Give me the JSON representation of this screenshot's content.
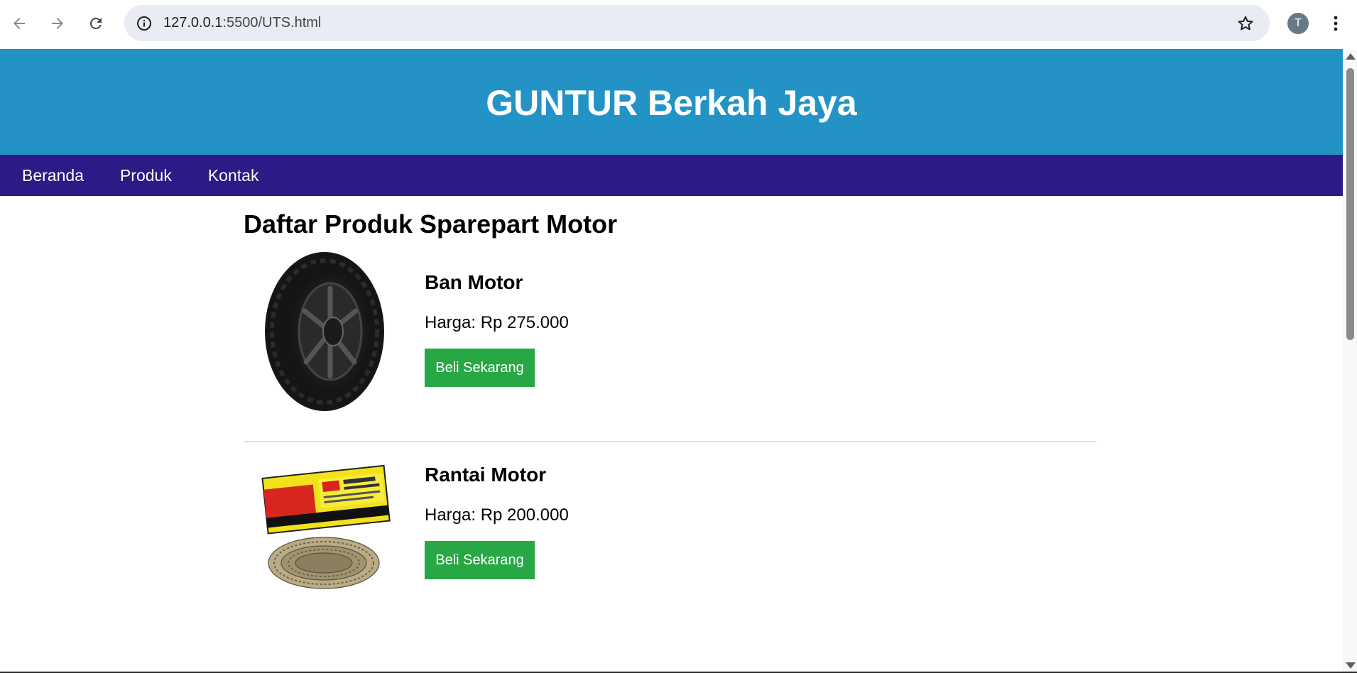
{
  "browser": {
    "url_host": "127.0.0.1",
    "url_path": ":5500/UTS.html",
    "profile_initial": "T"
  },
  "site": {
    "title": "GUNTUR Berkah Jaya",
    "nav": [
      "Beranda",
      "Produk",
      "Kontak"
    ]
  },
  "main": {
    "heading": "Daftar Produk Sparepart Motor",
    "products": [
      {
        "name": "Ban Motor",
        "price": "Harga: Rp 275.000",
        "button": "Beli Sekarang"
      },
      {
        "name": "Rantai Motor",
        "price": "Harga: Rp 200.000",
        "button": "Beli Sekarang"
      }
    ]
  },
  "colors": {
    "header_bg": "#2393c6",
    "nav_bg": "#2c1a86",
    "button_bg": "#28a745"
  }
}
